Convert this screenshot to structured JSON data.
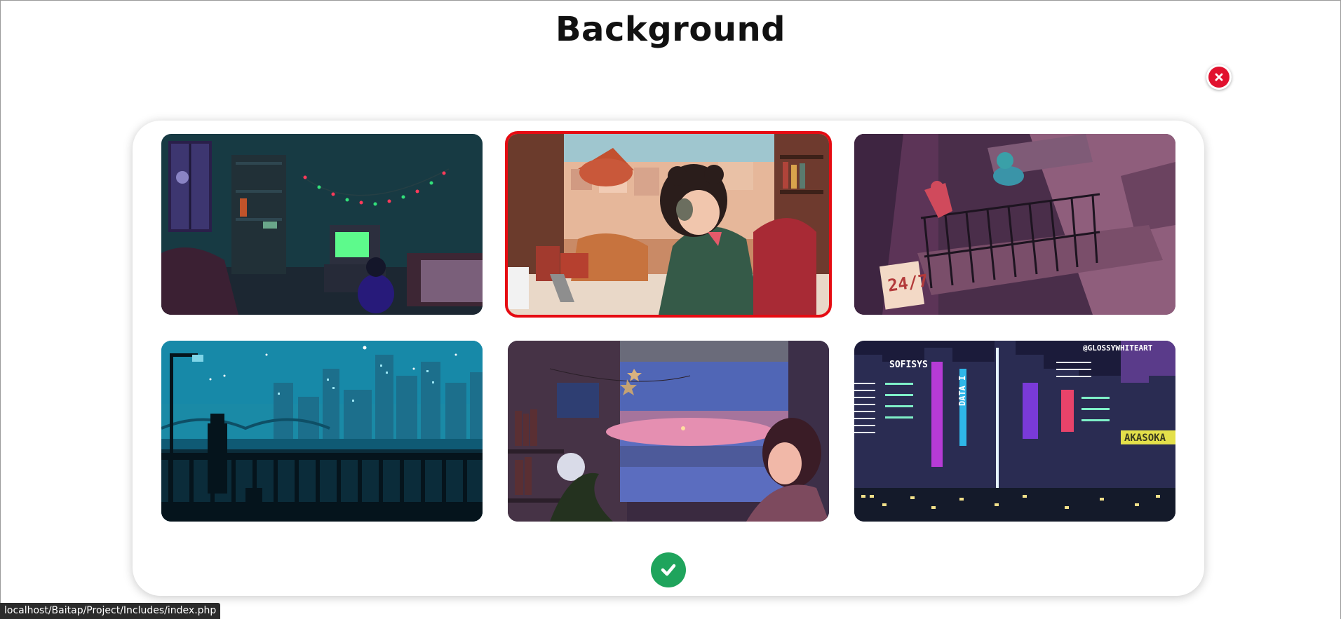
{
  "page": {
    "title": "Background"
  },
  "icons": {
    "close": "close-icon",
    "confirm": "check-icon"
  },
  "colors": {
    "close": "#e1112e",
    "confirm": "#1fa45c",
    "selected_outline": "#e60b12"
  },
  "backgrounds": [
    {
      "name": "lofi-room-tv",
      "selected": false
    },
    {
      "name": "lofi-girl-studying",
      "selected": true
    },
    {
      "name": "fire-escape-24-7",
      "selected": false,
      "sign_text": "24/7"
    },
    {
      "name": "pixel-city-night",
      "selected": false
    },
    {
      "name": "window-sunset-girl",
      "selected": false
    },
    {
      "name": "cyberpunk-city",
      "selected": false,
      "watermark": "@GLOSSYWHITEART",
      "signs": [
        "SOFISYS",
        "DATA I",
        "AKASOKA"
      ]
    }
  ],
  "status_bar": {
    "url": "localhost/Baitap/Project/Includes/index.php"
  }
}
